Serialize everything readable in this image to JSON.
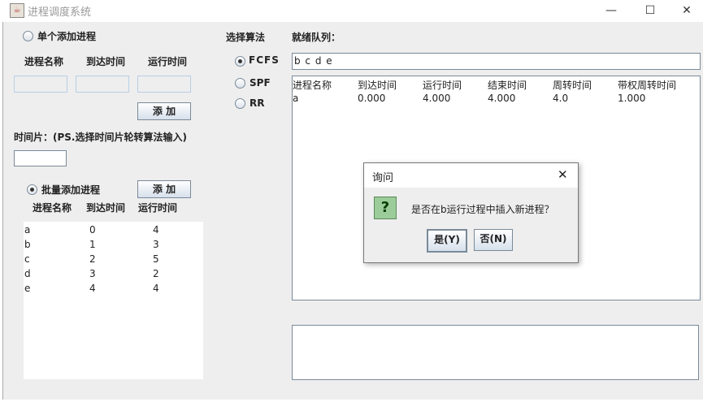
{
  "window": {
    "title": "进程调度系统",
    "minimize": "—",
    "maximize": "☐",
    "close": "✕"
  },
  "single": {
    "radio_label": "单个添加进程",
    "col_name": "进程名称",
    "col_arrive": "到达时间",
    "col_run": "运行时间",
    "add_label": "添 加"
  },
  "timeslice": {
    "label": "时间片：(PS.选择时间片轮转算法输入)",
    "value": ""
  },
  "batch": {
    "radio_label": "批量添加进程",
    "add_label": "添 加",
    "col_name": "进程名称",
    "col_arrive": "到达时间",
    "col_run": "运行时间",
    "rows": [
      [
        "a",
        "0",
        "4"
      ],
      [
        "b",
        "1",
        "3"
      ],
      [
        "c",
        "2",
        "5"
      ],
      [
        "d",
        "3",
        "2"
      ],
      [
        "e",
        "4",
        "4"
      ]
    ]
  },
  "algorithm": {
    "label": "选择算法",
    "options": [
      "FCFS",
      "SPF",
      "RR"
    ],
    "selected": "FCFS"
  },
  "ready": {
    "label": "就绪队列：",
    "value": "b c d e"
  },
  "results": {
    "headers": [
      "进程名称",
      "到达时间",
      "运行时间",
      "结束时间",
      "周转时间",
      "带权周转时间"
    ],
    "rows": [
      [
        "a",
        "0.000",
        "4.000",
        "4.000",
        "4.0",
        "1.000"
      ]
    ]
  },
  "dialog": {
    "title": "询问",
    "message": "是否在b运行过程中插入新进程？",
    "yes": "是(Y)",
    "no": "否(N)",
    "close": "✕",
    "icon": "?"
  }
}
